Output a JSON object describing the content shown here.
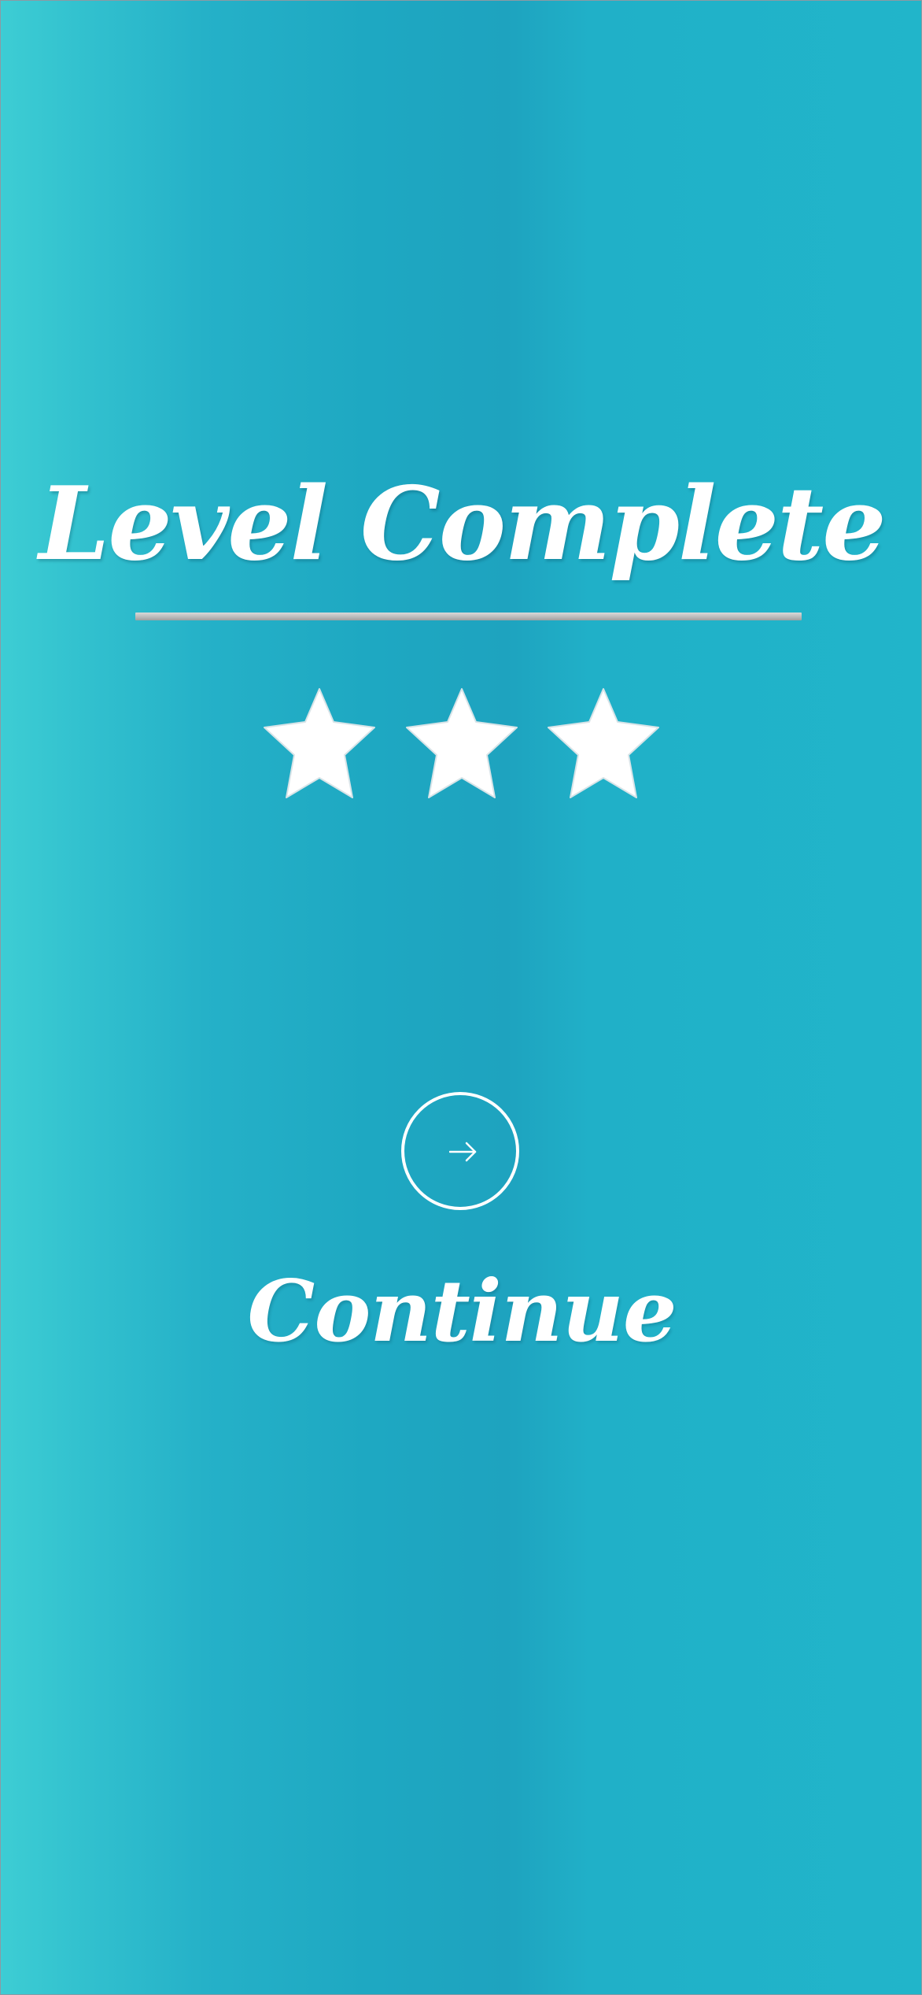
{
  "screen": {
    "title": "Level Complete",
    "continue_label": "Continue"
  },
  "rating": {
    "stars_earned": 3,
    "stars_total": 3
  },
  "icons": {
    "star": "star-icon",
    "continue": "arrow-right-icon"
  },
  "colors": {
    "gradient_left": "#3dcdd4",
    "gradient_mid": "#1ea3bf",
    "gradient_right": "#21b5ca",
    "text": "#ffffff",
    "divider": "#c4c4c4"
  }
}
